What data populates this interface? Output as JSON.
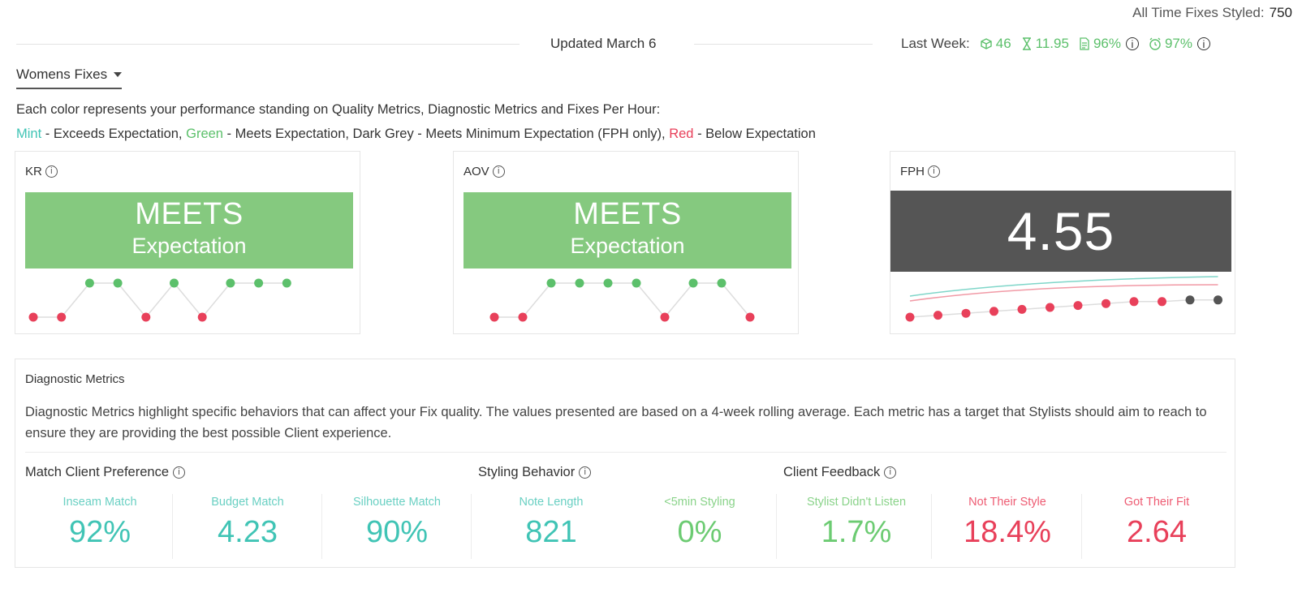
{
  "header": {
    "all_time_label": "All Time Fixes Styled:",
    "all_time_value": "750",
    "updated": "Updated March 6",
    "last_week_label": "Last Week:",
    "last_week": [
      {
        "icon": "box-icon",
        "value": "46"
      },
      {
        "icon": "hourglass-icon",
        "value": "11.95"
      },
      {
        "icon": "document-icon",
        "value": "96%"
      },
      {
        "icon": "clock-icon",
        "value": "97%"
      }
    ]
  },
  "selector": {
    "label": "Womens Fixes"
  },
  "legend": {
    "line1": "Each color represents your performance standing on Quality Metrics, Diagnostic Metrics and Fixes Per Hour:",
    "mint": "Mint",
    "mint_desc": " - Exceeds Expectation, ",
    "green": "Green",
    "green_desc": " - Meets Expectation, Dark Grey - Meets Minimum Expectation (FPH only), ",
    "red": "Red",
    "red_desc": " - Below Expectation"
  },
  "cards": {
    "kr": {
      "title": "KR",
      "status": "MEETS",
      "sub": "Expectation",
      "points": [
        "red",
        "red",
        "green",
        "green",
        "red",
        "green",
        "red",
        "green",
        "green",
        "green"
      ]
    },
    "aov": {
      "title": "AOV",
      "status": "MEETS",
      "sub": "Expectation",
      "points": [
        "red",
        "red",
        "green",
        "green",
        "green",
        "green",
        "red",
        "green",
        "green",
        "red"
      ]
    },
    "fph": {
      "title": "FPH",
      "value": "4.55",
      "points": [
        "red",
        "red",
        "red",
        "red",
        "red",
        "red",
        "red",
        "red",
        "red",
        "red",
        "grey",
        "grey"
      ]
    }
  },
  "colors": {
    "mint": "#40c4b5",
    "green": "#5cc06b",
    "red": "#e8405a",
    "grey": "#555555",
    "block_green": "#85c97f"
  },
  "diagnostic": {
    "title": "Diagnostic Metrics",
    "desc": "Diagnostic Metrics highlight specific behaviors that can affect your Fix quality. The values presented are based on a 4-week rolling average. Each metric has a target that Stylists should aim to reach to ensure they are providing the best possible Client experience.",
    "groups": [
      {
        "title": "Match Client Preference"
      },
      {
        "title": "Styling Behavior"
      },
      {
        "title": "Client Feedback"
      }
    ],
    "metrics": [
      {
        "label": "Inseam Match",
        "value": "92%",
        "color": "mint"
      },
      {
        "label": "Budget Match",
        "value": "4.23",
        "color": "mint"
      },
      {
        "label": "Silhouette Match",
        "value": "90%",
        "color": "mint"
      },
      {
        "label": "Note Length",
        "value": "821",
        "color": "mint"
      },
      {
        "label": "<5min Styling",
        "value": "0%",
        "color": "green"
      },
      {
        "label": "Stylist Didn't Listen",
        "value": "1.7%",
        "color": "green"
      },
      {
        "label": "Not Their Style",
        "value": "18.4%",
        "color": "red"
      },
      {
        "label": "Got Their Fit",
        "value": "2.64",
        "color": "red"
      }
    ]
  }
}
